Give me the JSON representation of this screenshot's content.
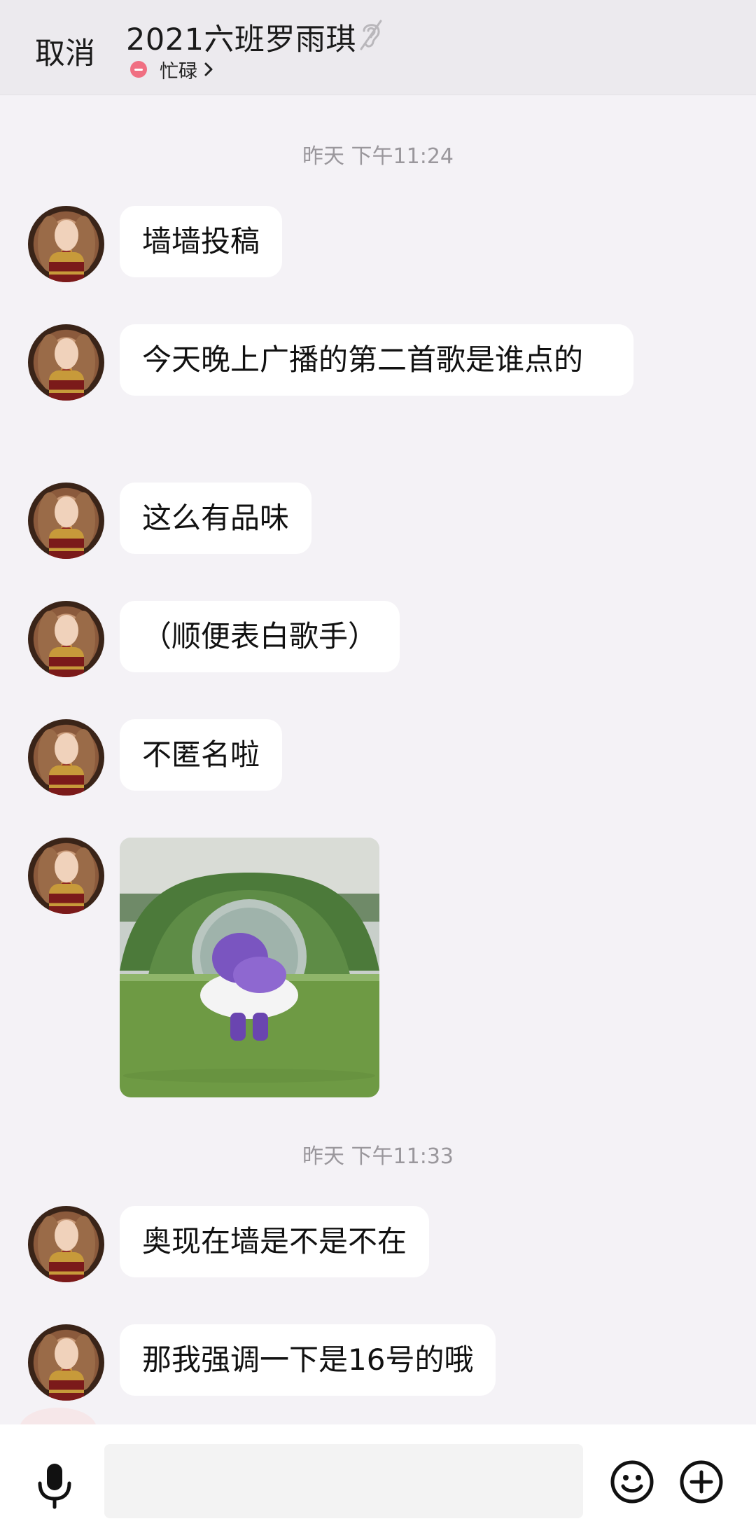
{
  "header": {
    "cancel_label": "取消",
    "title": "2021六班罗雨琪",
    "status": "忙碌",
    "icons": {
      "ear": "ear-icon",
      "status": "busy-status-icon",
      "chevron": "chevron-right-icon"
    }
  },
  "timestamps": [
    "昨天 下午11:24",
    "昨天 下午11:33"
  ],
  "messages": [
    {
      "text": "墙墙投稿"
    },
    {
      "text": "今天晚上广播的第二首歌是谁点的"
    },
    {
      "text": "这么有品味"
    },
    {
      "text": "（顺便表白歌手）"
    },
    {
      "text": "不匿名啦"
    },
    {
      "type": "image",
      "description": "purple-costume-dancer-gif"
    },
    {
      "text": "奥现在墙是不是不在"
    },
    {
      "text": "那我强调一下是16号的哦"
    }
  ],
  "input": {
    "placeholder": "",
    "icons": {
      "voice": "microphone-icon",
      "emoji": "smiley-icon",
      "more": "plus-circle-icon"
    }
  },
  "colors": {
    "background": "#f4f2f6",
    "bubble": "#ffffff",
    "busy": "#f06f82"
  }
}
